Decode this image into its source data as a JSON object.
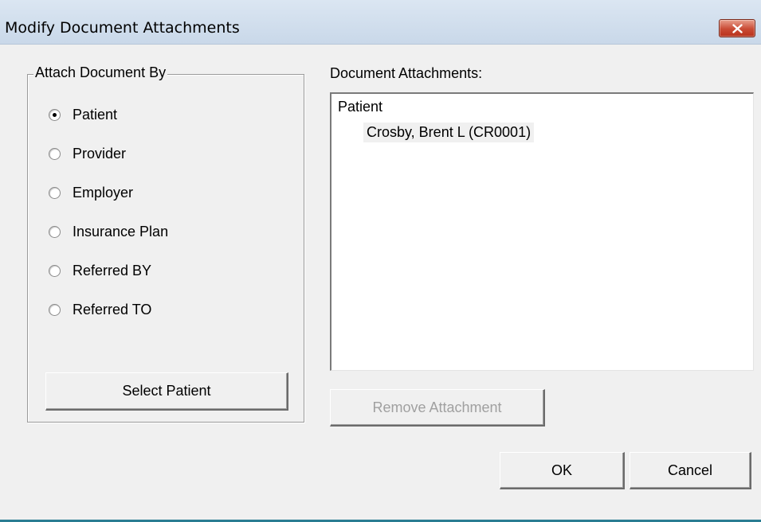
{
  "window": {
    "title": "Modify Document Attachments",
    "close_icon": "close-x-icon"
  },
  "attach_by": {
    "legend": "Attach Document By",
    "options": [
      {
        "label": "Patient",
        "checked": true
      },
      {
        "label": "Provider",
        "checked": false
      },
      {
        "label": "Employer",
        "checked": false
      },
      {
        "label": "Insurance Plan",
        "checked": false
      },
      {
        "label": "Referred BY",
        "checked": false
      },
      {
        "label": "Referred TO",
        "checked": false
      }
    ],
    "select_button_label": "Select Patient"
  },
  "attachments": {
    "label": "Document Attachments:",
    "tree": [
      {
        "label": "Patient",
        "children": [
          {
            "label": "Crosby, Brent L (CR0001)",
            "selected": true
          }
        ]
      }
    ],
    "remove_button_label": "Remove Attachment",
    "remove_enabled": false
  },
  "footer": {
    "ok_label": "OK",
    "cancel_label": "Cancel"
  },
  "colors": {
    "titlebar": "#c9d8e9",
    "close_button": "#c94a34",
    "dialog_background": "#f0f0f0"
  }
}
